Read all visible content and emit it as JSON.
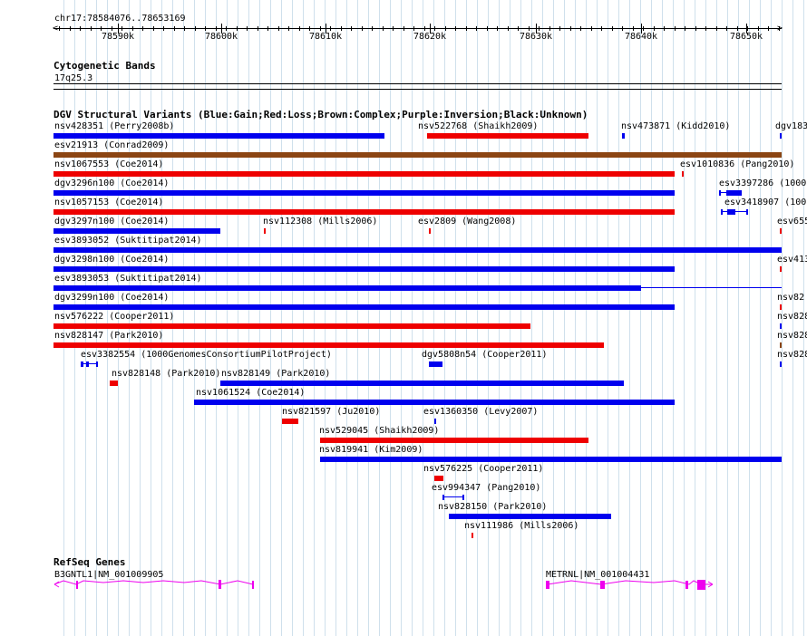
{
  "colors": {
    "gain": "#0000ee",
    "loss": "#ee0000",
    "complex": "#8b4513",
    "inversion": "#800080",
    "unknown": "#000000",
    "gene": "#ee00ee",
    "grid": "#cfe0ec"
  },
  "ruler": {
    "region": "chr17:78584076..78653169",
    "ticks": [
      "78590k",
      "78600k",
      "78610k",
      "78620k",
      "78630k",
      "78640k",
      "78650k"
    ]
  },
  "cytoband": {
    "title": "Cytogenetic Bands",
    "band": "17q25.3"
  },
  "dgv": {
    "title": "DGV Structural Variants (Blue:Gain;Red:Loss;Brown:Complex;Purple:Inversion;Black:Unknown)",
    "variants": [
      {
        "label": "nsv428351 (Perry2008b)",
        "type": "gain",
        "bars": [
          [
            78584076,
            78615500
          ]
        ]
      },
      {
        "label": "nsv522768 (Shaikh2009)",
        "type": "loss",
        "bars": [
          [
            78619500,
            78634800
          ]
        ]
      },
      {
        "label": "nsv473871 (Kidd2010)",
        "type": "gain",
        "bars": [
          [
            78638000,
            78638250
          ]
        ]
      },
      {
        "label": "dgv183",
        "type": "gain",
        "bars": [
          [
            78653000,
            78653169
          ]
        ]
      },
      {
        "label": "esv21913 (Conrad2009)",
        "type": "complex",
        "bars": [
          [
            78584076,
            78653169
          ]
        ]
      },
      {
        "label": "nsv1067553 (Coe2014)",
        "type": "loss",
        "bars": [
          [
            78584076,
            78643000
          ]
        ]
      },
      {
        "label": "esv1010836 (Pang2010)",
        "type": "loss",
        "bars": [
          [
            78643700,
            78643800
          ]
        ]
      },
      {
        "label": "dgv3296n100 (Coe2014)",
        "type": "gain",
        "bars": [
          [
            78584076,
            78643000
          ]
        ]
      },
      {
        "label": "esv3397286 (1000",
        "type": "gain",
        "bars": [
          [
            78647200,
            78647300
          ],
          [
            78647900,
            78649400
          ]
        ]
      },
      {
        "label": "nsv1057153 (Coe2014)",
        "type": "loss",
        "bars": [
          [
            78584076,
            78643000
          ]
        ]
      },
      {
        "label": "esv3418907 (100",
        "type": "gain",
        "bars": [
          [
            78647400,
            78647500
          ],
          [
            78648000,
            78648800
          ],
          [
            78649800,
            78649900
          ]
        ]
      },
      {
        "label": "dgv3297n100 (Coe2014)",
        "type": "gain",
        "bars": [
          [
            78584076,
            78599900
          ]
        ]
      },
      {
        "label": "nsv112308 (Mills2006)",
        "type": "loss",
        "bars": [
          [
            78604000,
            78604200
          ]
        ]
      },
      {
        "label": "esv2809 (Wang2008)",
        "type": "loss",
        "bars": [
          [
            78619700,
            78619900
          ]
        ]
      },
      {
        "label": "esv655",
        "type": "loss",
        "bars": [
          [
            78653000,
            78653169
          ]
        ]
      },
      {
        "label": "esv3893052 (Suktitipat2014)",
        "type": "gain",
        "bars": [
          [
            78584076,
            78653169
          ]
        ]
      },
      {
        "label": "dgv3298n100 (Coe2014)",
        "type": "gain",
        "bars": [
          [
            78584076,
            78643000
          ]
        ]
      },
      {
        "label": "esv413",
        "type": "loss",
        "bars": [
          [
            78653000,
            78653169
          ]
        ]
      },
      {
        "label": "esv3893053 (Suktitipat2014)",
        "type": "gain",
        "bars": [
          [
            78584076,
            78639800
          ]
        ]
      },
      {
        "label": "dgv3299n100 (Coe2014)",
        "type": "gain",
        "bars": [
          [
            78584076,
            78643000
          ]
        ]
      },
      {
        "label": "nsv82",
        "type": "loss",
        "bars": [
          [
            78653000,
            78653169
          ]
        ]
      },
      {
        "label": "nsv576222 (Cooper2011)",
        "type": "loss",
        "bars": [
          [
            78584076,
            78629300
          ]
        ]
      },
      {
        "label": "nsv828",
        "type": "gain",
        "bars": [
          [
            78653000,
            78653169
          ]
        ]
      },
      {
        "label": "nsv828147 (Park2010)",
        "type": "loss",
        "bars": [
          [
            78584076,
            78636300
          ]
        ]
      },
      {
        "label": "nsv828",
        "type": "complex",
        "bars": [
          [
            78653000,
            78653169
          ]
        ]
      },
      {
        "label": "esv3382554 (1000GenomesConsortiumPilotProject)",
        "type": "gain",
        "bars": [
          [
            78586700,
            78586900
          ],
          [
            78587200,
            78587400
          ],
          [
            78588100,
            78588300
          ]
        ]
      },
      {
        "label": "dgv5808n54 (Cooper2011)",
        "type": "gain",
        "bars": [
          [
            78619700,
            78621000
          ]
        ]
      },
      {
        "label": "nsv828",
        "type": "gain",
        "bars": [
          [
            78653000,
            78653169
          ]
        ]
      },
      {
        "label": "nsv828148 (Park2010)",
        "type": "loss",
        "bars": [
          [
            78589400,
            78590200
          ]
        ]
      },
      {
        "label": "nsv828149 (Park2010)",
        "type": "gain",
        "bars": [
          [
            78599900,
            78638200
          ]
        ]
      },
      {
        "label": "nsv1061524 (Coe2014)",
        "type": "gain",
        "bars": [
          [
            78597400,
            78643000
          ]
        ]
      },
      {
        "label": "nsv821597 (Ju2010)",
        "type": "loss",
        "bars": [
          [
            78605800,
            78607300
          ]
        ]
      },
      {
        "label": "esv1360350 (Levy2007)",
        "type": "gain",
        "bars": [
          [
            78620200,
            78620400
          ]
        ]
      },
      {
        "label": "nsv529045 (Shaikh2009)",
        "type": "loss",
        "bars": [
          [
            78609400,
            78634800
          ]
        ]
      },
      {
        "label": "nsv819941 (Kim2009)",
        "type": "gain",
        "bars": [
          [
            78609400,
            78653169
          ]
        ]
      },
      {
        "label": "nsv576225 (Cooper2011)",
        "type": "loss",
        "bars": [
          [
            78620200,
            78621100
          ]
        ]
      },
      {
        "label": "esv994347 (Pang2010)",
        "type": "gain",
        "bars": [
          [
            78621000,
            78621100
          ],
          [
            78622900,
            78623000
          ]
        ]
      },
      {
        "label": "nsv828150 (Park2010)",
        "type": "gain",
        "bars": [
          [
            78621600,
            78637000
          ]
        ]
      },
      {
        "label": "nsv111986 (Mills2006)",
        "type": "loss",
        "bars": [
          [
            78623700,
            78623900
          ]
        ]
      }
    ]
  },
  "refseq": {
    "title": "RefSeq Genes",
    "genes": [
      {
        "label": "B3GNTL1|NM_001009905"
      },
      {
        "label": "METRNL|NM_001004431"
      }
    ]
  }
}
